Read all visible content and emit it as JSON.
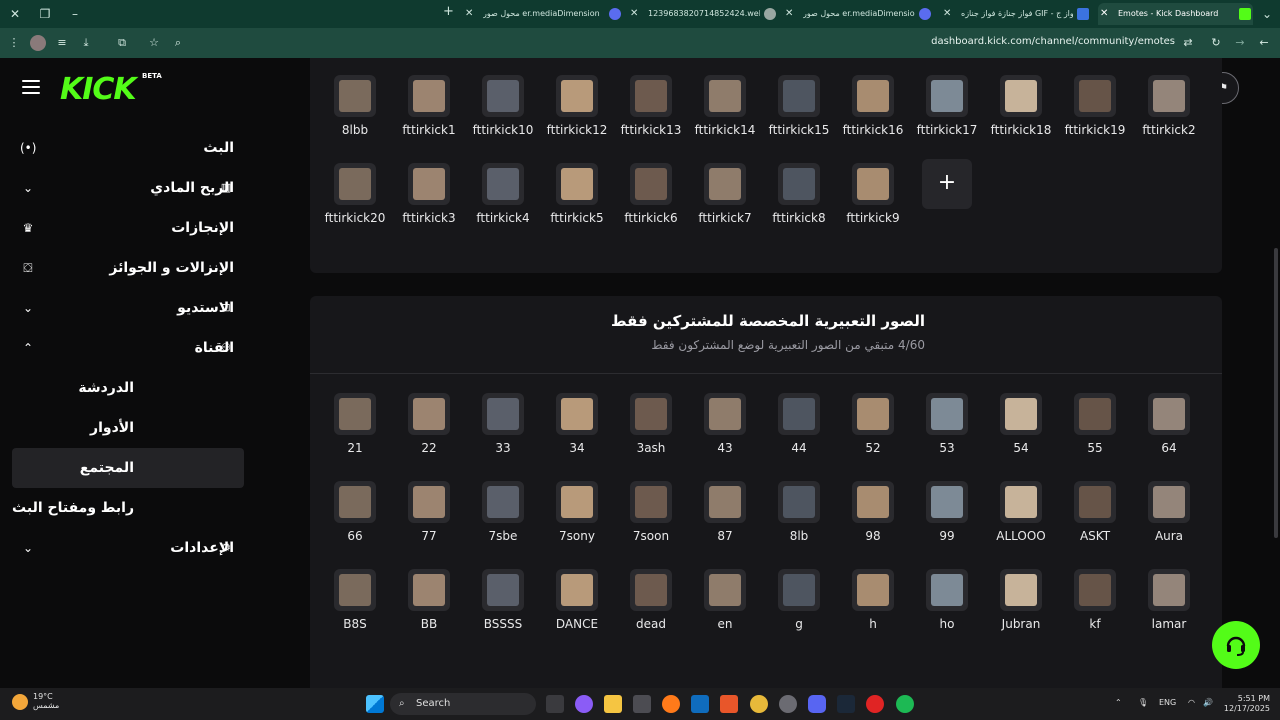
{
  "browser": {
    "tabs": [
      {
        "title": "Emotes - Kick Dashboard",
        "active": true
      },
      {
        "title": "فواز جنازة فواز جنازه GIF - فواز ج",
        "active": false
      },
      {
        "title": "محول صور er.mediaDimension",
        "active": false
      },
      {
        "title": "1239683820714852424.webp (",
        "active": false
      },
      {
        "title": "محول صور er.mediaDimension",
        "active": false
      }
    ],
    "url": "dashboard.kick.com/channel/community/emotes",
    "accent": "#0f3a2f"
  },
  "header": {
    "logo": "KICK",
    "badge": "BETA"
  },
  "sidebar": {
    "items": [
      {
        "label": "البث",
        "icon": "broadcast-icon"
      },
      {
        "label": "الربح المادي",
        "icon": "chart-icon"
      },
      {
        "label": "الإنجازات",
        "icon": "trophy-icon"
      },
      {
        "label": "الإنزالات و الجوائز",
        "icon": "drops-icon"
      },
      {
        "label": "الاستديو",
        "icon": "studio-icon"
      },
      {
        "label": "القناة",
        "icon": "channel-icon"
      },
      {
        "label": "الدردشة"
      },
      {
        "label": "الأدوار"
      },
      {
        "label": "المجتمع"
      },
      {
        "label": "رابط ومفتاح البث"
      },
      {
        "label": "الإعدادات",
        "icon": "gear-icon"
      }
    ]
  },
  "channel_emotes": {
    "row1": [
      "8lbb",
      "fttirkick1",
      "fttirkick10",
      "fttirkick12",
      "fttirkick13",
      "fttirkick14",
      "fttirkick15",
      "fttirkick16",
      "fttirkick17",
      "fttirkick18",
      "fttirkick19",
      "fttirkick2"
    ],
    "row2": [
      "fttirkick20",
      "fttirkick3",
      "fttirkick4",
      "fttirkick5",
      "fttirkick6",
      "fttirkick7",
      "fttirkick8",
      "fttirkick9"
    ],
    "add_label": "+"
  },
  "subscriber_section": {
    "title": "الصور التعبيرية المخصصة للمشتركين فقط",
    "subtitle": "4/60 متبقي من الصور التعبيرية لوضع المشتركون فقط",
    "row1": [
      "21",
      "22",
      "33",
      "34",
      "3ash",
      "43",
      "44",
      "52",
      "53",
      "54",
      "55",
      "64"
    ],
    "row2": [
      "66",
      "77",
      "7sbe",
      "7sony",
      "7soon",
      "87",
      "8lb",
      "98",
      "99",
      "ALLOOO",
      "ASKT",
      "Aura"
    ],
    "row3": [
      "B8S",
      "BB",
      "BSSSS",
      "DANCE",
      "dead",
      "en",
      "g",
      "h",
      "ho",
      "Jubran",
      "kf",
      "lamar"
    ]
  },
  "taskbar": {
    "weather_temp": "19°C",
    "weather_desc": "مشمس",
    "search_label": "Search",
    "language": "ENG",
    "time": "5:51 PM",
    "date": "12/17/2025"
  }
}
